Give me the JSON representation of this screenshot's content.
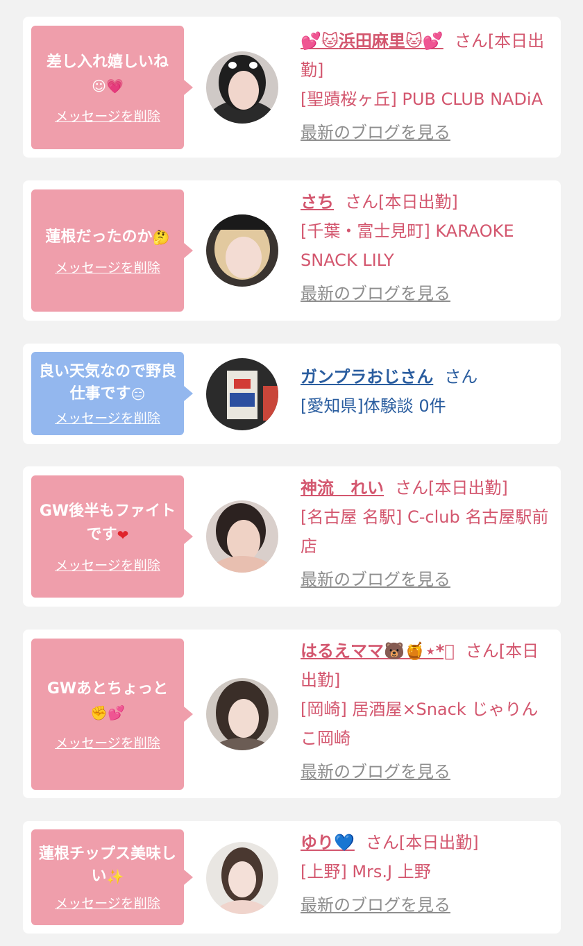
{
  "items": [
    {
      "message": "差し入れ嬉しいね",
      "message_emojis": "☺💗",
      "delete_label": "メッセージを削除",
      "name_prefix": "💕🐱",
      "name": "浜田麻里",
      "name_suffix": "🐱💕",
      "honorific": "さん",
      "status": "[本日出勤]",
      "shop": "[聖蹟桜ヶ丘] PUB CLUB NADiA",
      "blog_label": "最新のブログを見る"
    },
    {
      "message": "蓮根だったのか",
      "message_emojis": "🤔",
      "delete_label": "メッセージを削除",
      "name_prefix": "",
      "name": "さち",
      "name_suffix": "",
      "honorific": "さん",
      "status": "[本日出勤]",
      "shop": "[千葉・富士見町] KARAOKE SNACK LILY",
      "blog_label": "最新のブログを見る"
    },
    {
      "message": "良い天気なので野良仕事です",
      "message_emojis": "😑",
      "delete_label": "メッセージを削除",
      "name_prefix": "",
      "name": "ガンプラおじさん",
      "name_suffix": "",
      "honorific": "さん",
      "status": "",
      "shop": "[愛知県]体験談 0件",
      "blog_label": ""
    },
    {
      "message": "GW後半もファイトです",
      "message_emojis": "❤",
      "delete_label": "メッセージを削除",
      "name_prefix": "",
      "name": "神流　れい",
      "name_suffix": "",
      "honorific": "さん",
      "status": "[本日出勤]",
      "shop": "[名古屋 名駅] C-club 名古屋駅前店",
      "blog_label": "最新のブログを見る"
    },
    {
      "message": "GWあとちょっと",
      "message_emojis": "✊💕",
      "delete_label": "メッセージを削除",
      "name_prefix": "",
      "name": "はるえママ",
      "name_suffix": "🐻🍯⋆*ﾟ",
      "honorific": "さん",
      "status": "[本日出勤]",
      "shop": "[岡崎] 居酒屋×Snack じゃりんこ岡崎",
      "blog_label": "最新のブログを見る"
    },
    {
      "message": "蓮根チップス美味しい",
      "message_emojis": "✨",
      "delete_label": "メッセージを削除",
      "name_prefix": "",
      "name": "ゆり",
      "name_suffix": "💙",
      "honorific": "さん",
      "status": "[本日出勤]",
      "shop": "[上野] Mrs.J 上野",
      "blog_label": "最新のブログを見る"
    }
  ],
  "colors": {
    "bubble_pink": "#ef9eab",
    "bubble_blue": "#93b7ee",
    "cast_text": "#d3566e",
    "user_text": "#2a5d9f",
    "blog_link": "#8e8e8e",
    "background": "#f2f2f2"
  }
}
